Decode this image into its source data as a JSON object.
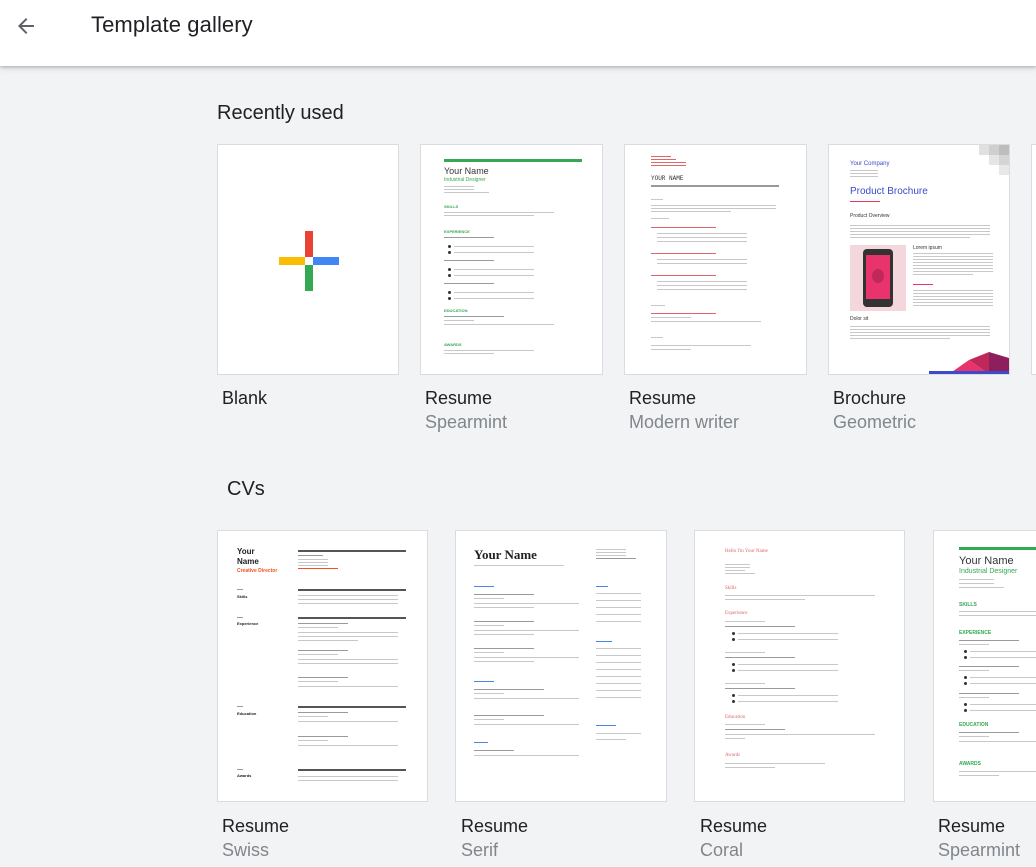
{
  "header": {
    "title": "Template gallery"
  },
  "recent": {
    "heading": "Recently used",
    "items": [
      {
        "name": "Blank",
        "sub": ""
      },
      {
        "name": "Resume",
        "sub": "Spearmint"
      },
      {
        "name": "Resume",
        "sub": "Modern writer"
      },
      {
        "name": "Brochure",
        "sub": "Geometric"
      }
    ]
  },
  "cvs": {
    "heading": "CVs",
    "items": [
      {
        "name": "Resume",
        "sub": "Swiss"
      },
      {
        "name": "Resume",
        "sub": "Serif"
      },
      {
        "name": "Resume",
        "sub": "Coral"
      },
      {
        "name": "Resume",
        "sub": "Spearmint"
      }
    ]
  },
  "thumbs": {
    "spearmint": {
      "name": "Your Name",
      "role": "Industrial Designer",
      "skills": "SKILLS",
      "experience": "EXPERIENCE",
      "education": "EDUCATION",
      "awards": "AWARDS"
    },
    "modern": {
      "name": "YOUR NAME"
    },
    "brochure": {
      "company": "Your Company",
      "title": "Product Brochure",
      "overview": "Product Overview",
      "lorem": "Lorem ipsum",
      "dolor": "Dolor sit"
    },
    "swiss": {
      "name": "Your Name",
      "role": "Creative Director",
      "skills": "Skills",
      "experience": "Experience",
      "education": "Education",
      "awards": "Awards"
    },
    "serif": {
      "name": "Your Name"
    },
    "coral": {
      "name": "Hello I'm Your Name",
      "skills": "Skills",
      "experience": "Experience",
      "education": "Education",
      "awards": "Awards"
    }
  },
  "colors": {
    "accent_green": "#34a853",
    "coral": "#e06666",
    "brochure_blue": "#3c4bc8",
    "brochure_pink": "#e8336d"
  }
}
